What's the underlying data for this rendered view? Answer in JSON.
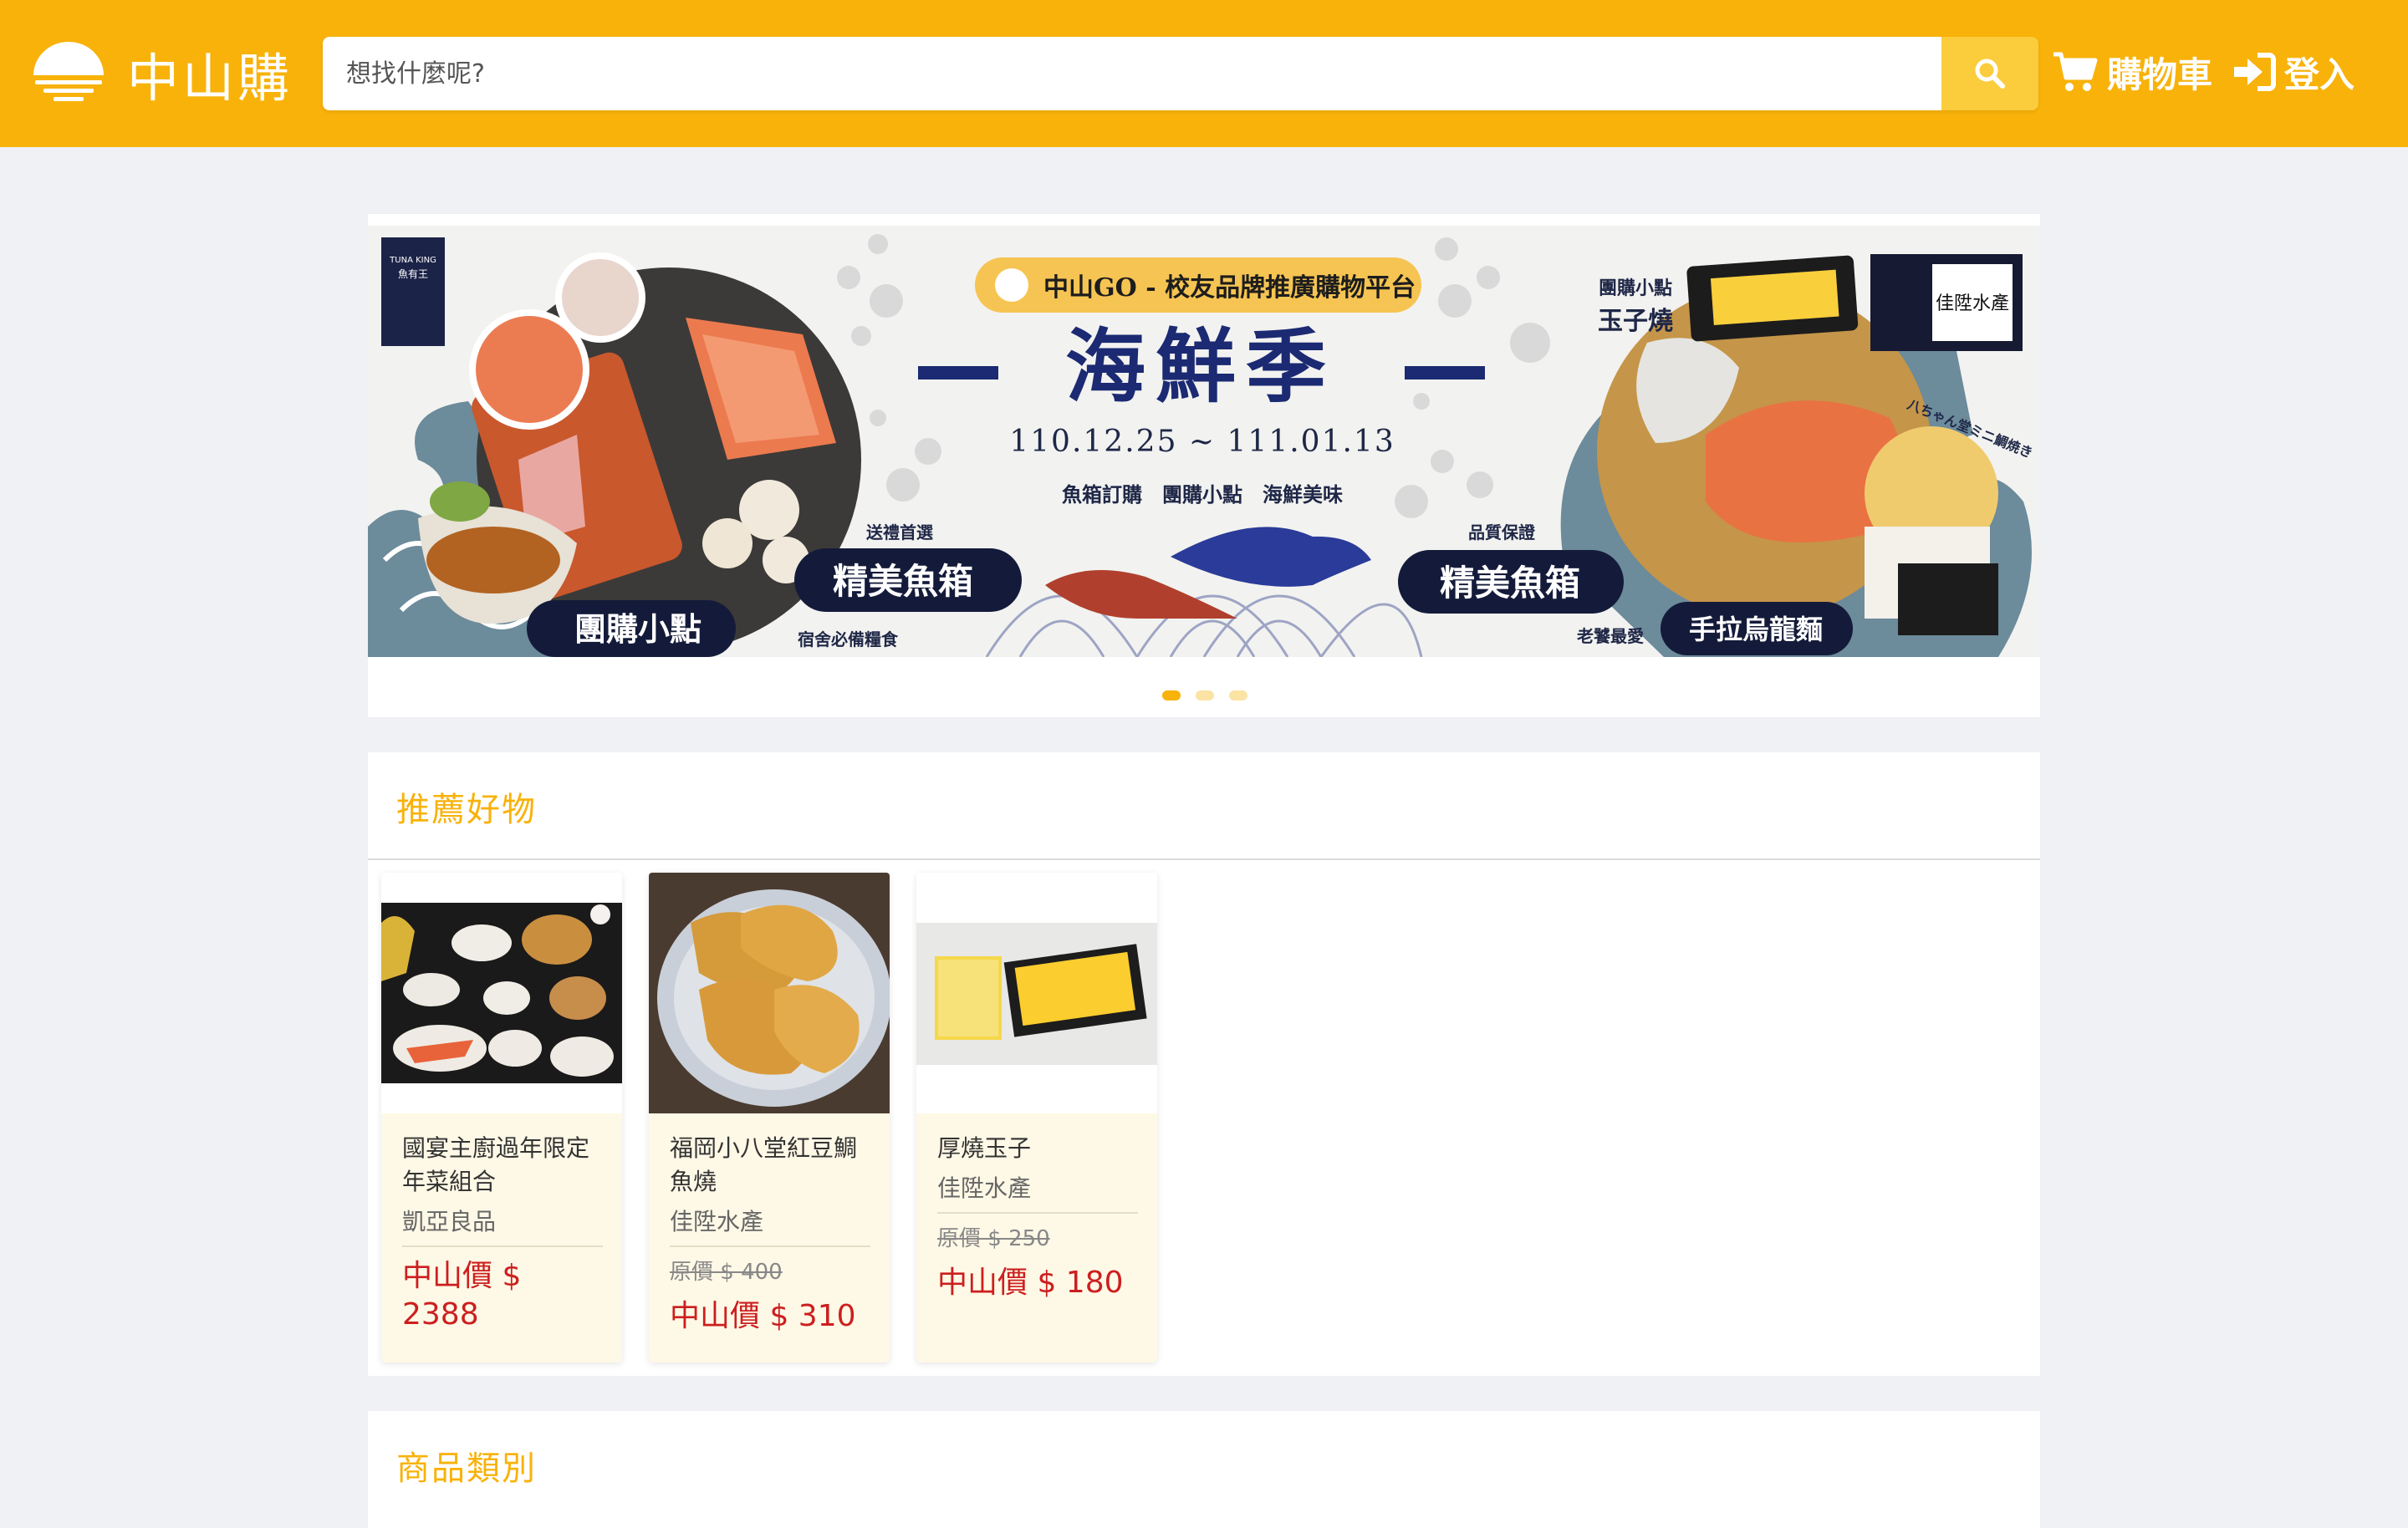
{
  "header": {
    "logo_text": "中山購",
    "search": {
      "placeholder": "想找什麼呢?",
      "value": ""
    },
    "cart_label": "購物車",
    "login_label": "登入",
    "colors": {
      "brand": "#f8b20a",
      "search_button": "#fbcc3c"
    }
  },
  "banner": {
    "badge_text": "中山GO - 校友品牌推廣購物平台",
    "headline": "海鮮季",
    "date_range": "110.12.25 ~ 111.01.13",
    "subtitle": "魚箱訂購　團購小點　海鮮美味",
    "left_logo_text": "TUNA KING 魚有王",
    "right_logo_text": "佳陞水產",
    "tags": [
      {
        "small": "送禮首選",
        "big": "精美魚箱"
      },
      {
        "small": "",
        "big": "團購小點"
      },
      {
        "small": "宿舍必備糧食",
        "big": ""
      },
      {
        "small": "品質保證",
        "big": "精美魚箱"
      },
      {
        "small": "老饕最愛",
        "big": "手拉烏龍麵"
      },
      {
        "small": "團購小點",
        "big": "玉子燒"
      },
      {
        "small": "八ちゃん堂ミニ鯛焼き",
        "big": ""
      }
    ],
    "slide_count": 3,
    "active_slide": 1
  },
  "recommended": {
    "title": "推薦好物",
    "products": [
      {
        "name": "國宴主廚過年限定年菜組合",
        "brand": "凱亞良品",
        "original_price": "",
        "price": "中山價 $ 2388",
        "image_icon": "banquet-dishes"
      },
      {
        "name": "福岡小八堂紅豆鯛魚燒",
        "brand": "佳陞水產",
        "original_price": "原價 $ 400",
        "price": "中山價 $ 310",
        "image_icon": "taiyaki-plate"
      },
      {
        "name": "厚燒玉子",
        "brand": "佳陞水產",
        "original_price": "原價 $ 250",
        "price": "中山價 $ 180",
        "image_icon": "tamagoyaki-tray"
      }
    ]
  },
  "categories": {
    "title": "商品類別"
  }
}
